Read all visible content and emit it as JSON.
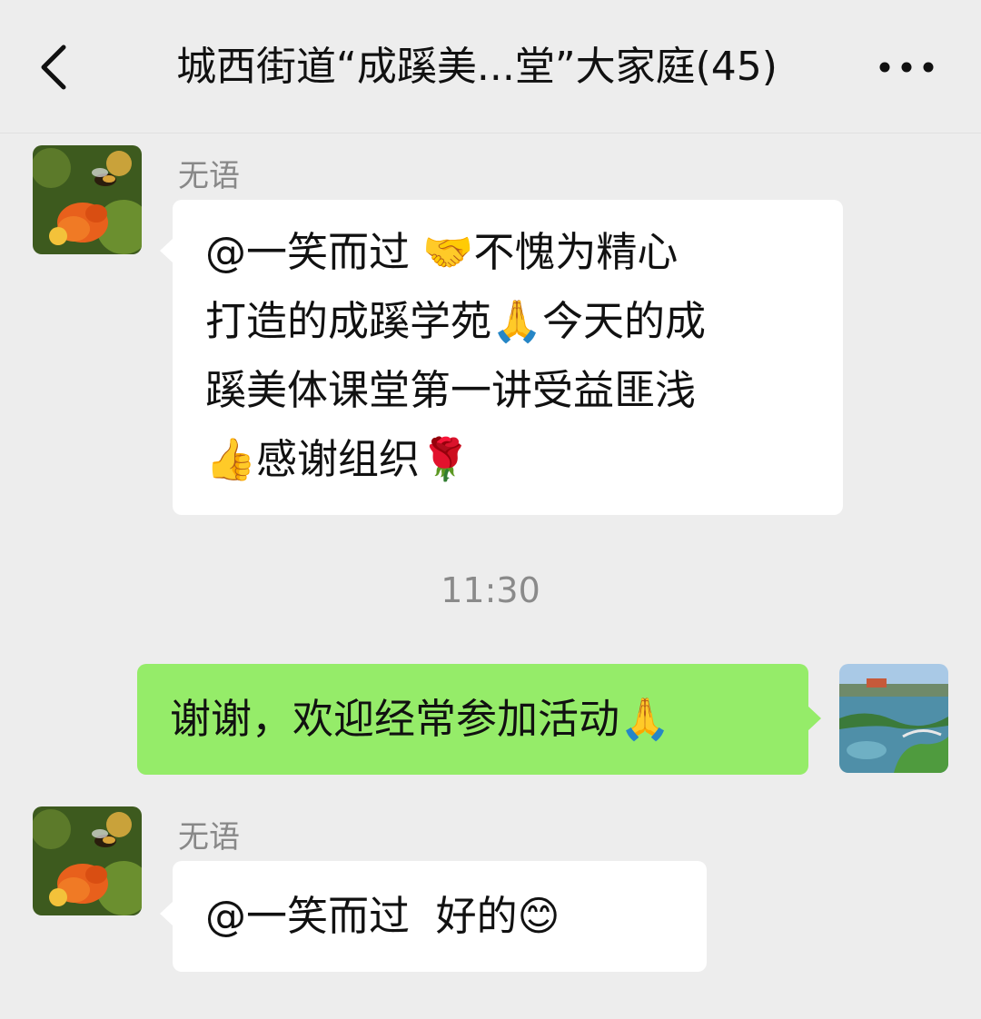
{
  "header": {
    "title": "城西街道“成蹊美...堂”大家庭(45)",
    "back_icon": "chevron-left-icon",
    "more_icon": "ellipsis-icon"
  },
  "messages": [
    {
      "sender": "无语",
      "direction": "incoming",
      "lines": [
        "@一笑而过 🤝不愧为精心",
        "打造的成蹊学苑🙏今天的成",
        "蹊美体课堂第一讲受益匪浅",
        "👍感谢组织🌹"
      ]
    },
    {
      "direction": "outgoing",
      "text": "谢谢，欢迎经常参加活动🙏"
    },
    {
      "sender": "无语",
      "direction": "incoming",
      "text": "@一笑而过  好的😊"
    }
  ],
  "timestamp": "11:30",
  "colors": {
    "background": "#ededed",
    "incoming_bubble": "#ffffff",
    "outgoing_bubble": "#95ec69",
    "sender_name": "#888888",
    "timestamp": "#8a8a8a"
  }
}
